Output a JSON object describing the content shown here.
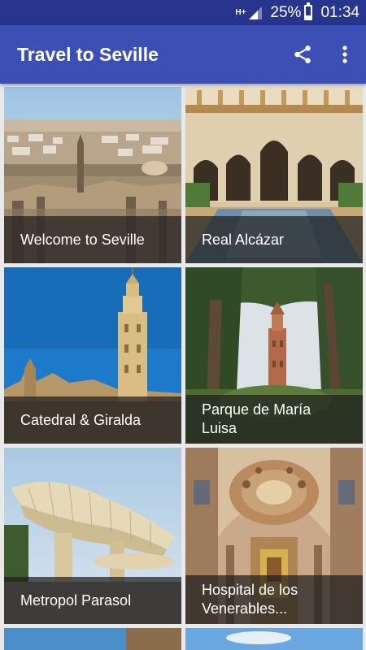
{
  "status_bar": {
    "network_type": "H+",
    "battery_text": "25%",
    "battery_level": 0.25,
    "time": "01:34"
  },
  "app_bar": {
    "title": "Travel to Seville",
    "share_icon": "share-icon",
    "more_icon": "more-vert-icon"
  },
  "places": [
    {
      "line1": "Welcome to Seville",
      "line2": ""
    },
    {
      "line1": "Real Alcázar",
      "line2": ""
    },
    {
      "line1": "Catedral & Giralda",
      "line2": ""
    },
    {
      "line1": "Parque de María",
      "line2": "Luisa"
    },
    {
      "line1": "Metropol Parasol",
      "line2": ""
    },
    {
      "line1": "Hospital de los",
      "line2": "Venerables..."
    }
  ],
  "colors": {
    "status_bar": "#27358f",
    "app_bar": "#3c4fb5",
    "background": "#e9e9e9"
  }
}
